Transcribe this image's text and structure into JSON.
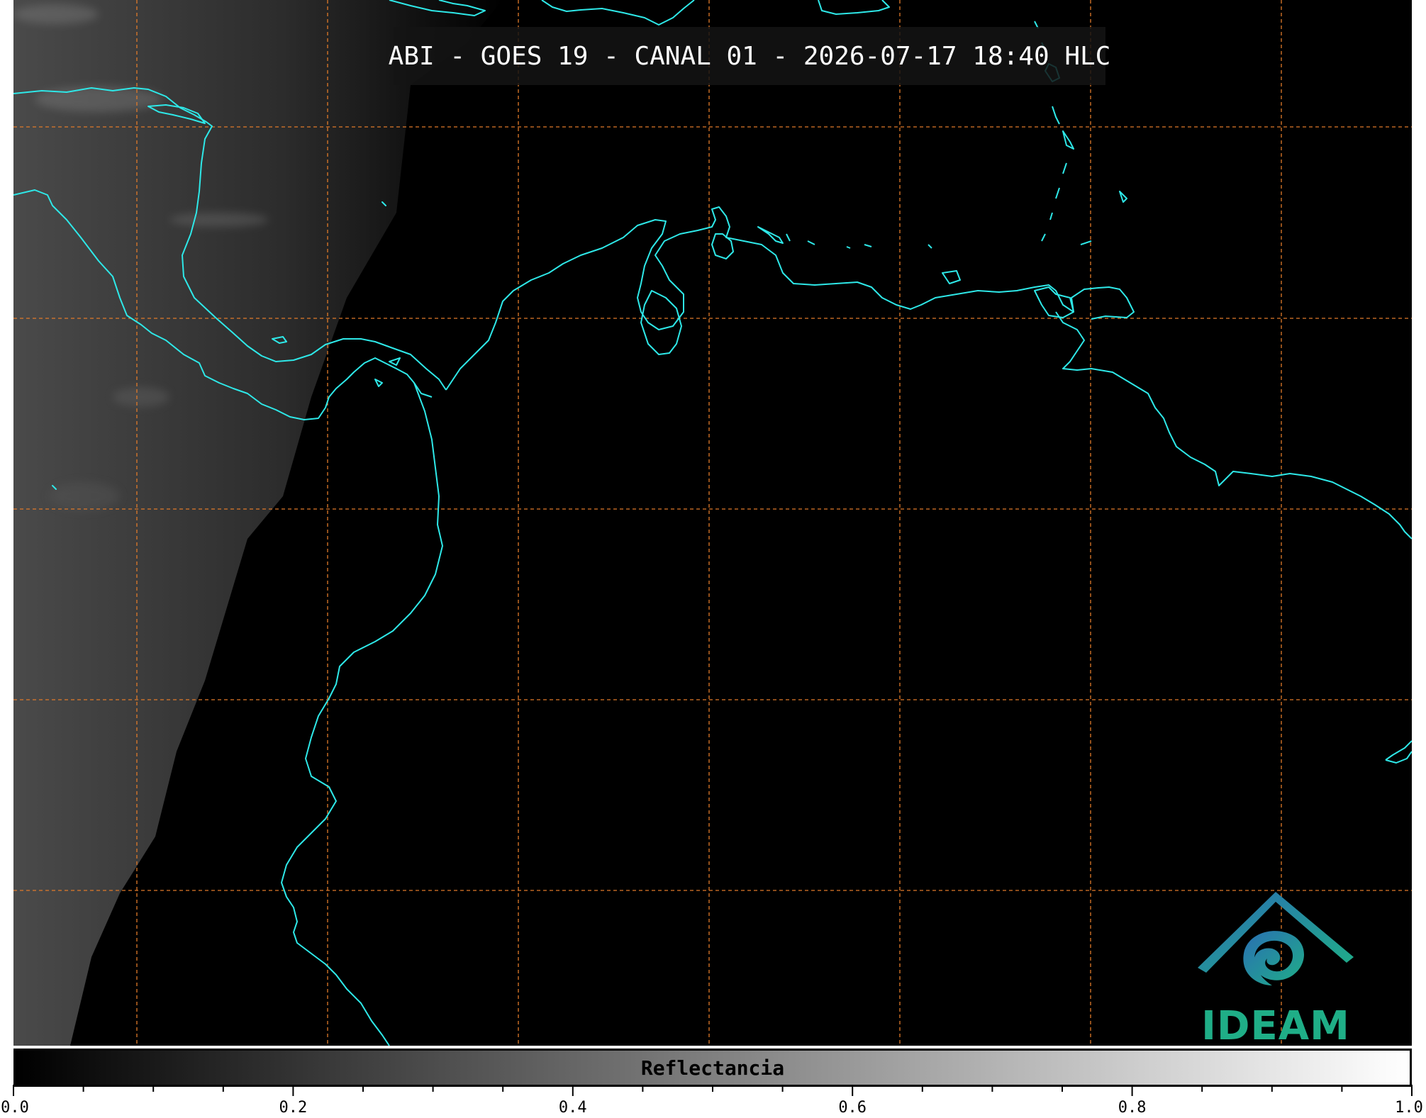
{
  "title": "ABI - GOES 19 - CANAL 01 - 2026-07-17 18:40 HLC",
  "colorbar": {
    "label": "Reflectancia",
    "min": 0.0,
    "max": 1.0,
    "tick_labels": [
      "0.0",
      "0.2",
      "0.4",
      "0.6",
      "0.8",
      "1.0"
    ],
    "gradient_colors": [
      "#000000",
      "#ffffff"
    ]
  },
  "logo": {
    "text": "IDEAM",
    "colors": [
      "#2a6fb3",
      "#1fae87"
    ]
  },
  "map": {
    "coastline_color": "#2ee8e8",
    "grid_color": "#e07a2a",
    "grid_style": "dashed",
    "background_color": "#000000"
  }
}
